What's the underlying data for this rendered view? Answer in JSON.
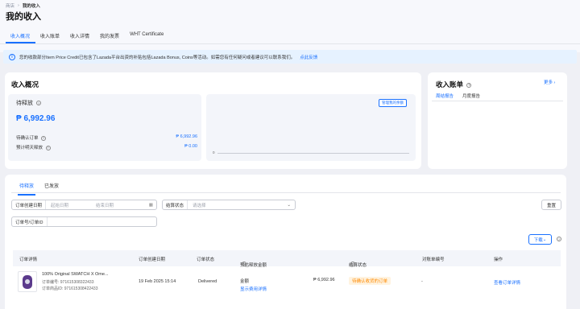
{
  "breadcrumb": {
    "home": "商店",
    "current": "我的收入"
  },
  "page_title": "我的收入",
  "tabs": [
    "收入概况",
    "收入账单",
    "收入详情",
    "我的发票",
    "WHT Certificate"
  ],
  "notice": {
    "text": "您的收款部分Item Price Credit已包含了Lazada平台出资的补贴包括Lazada Bonus, Coins等活动。如需您有任何疑问或者建议可以联系我们。",
    "link": "点此反馈"
  },
  "overview": {
    "title": "收入概况",
    "pending_label": "待释放",
    "pending_amount": "₱ 6,992.96",
    "to_confirm_label": "待确认订单",
    "to_confirm_value": "₱ 6,992.96",
    "expected_label": "预计明天释放",
    "expected_value": "₱ 0.00",
    "manage_button": "管理我的余额",
    "chart_zero": "0"
  },
  "statement": {
    "title": "收入账单",
    "more": "更多",
    "tabs": [
      "周结报告",
      "月度报告"
    ]
  },
  "details": {
    "subtabs": [
      "待释放",
      "已发放"
    ],
    "filters": {
      "created_date_label": "订单创建日期",
      "start_placeholder": "起始日期",
      "end_placeholder": "结束日期",
      "settle_status_label": "结算状态",
      "settle_status_placeholder": "请选择",
      "order_id_label": "订单号/订单ID"
    },
    "reset": "重置",
    "download": "下载",
    "columns": [
      "订单详情",
      "订单创建日期",
      "订单状态",
      "预估释放金额",
      "结算状态",
      "对账单编号",
      "操作"
    ],
    "row": {
      "product": "100% Original SWATCH X Ome...",
      "order_no": "订单编号: 971615308322433",
      "order_id": "订单商品ID: 971615308422433",
      "date": "19 Feb 2025 15:14",
      "status": "Delivered",
      "amount_label": "金额",
      "amount": "₱ 6,992.96",
      "fee_detail": "显示费用详情",
      "settle_status": "待确认收货的订单",
      "statement_no": "-",
      "action": "查看订单详情"
    }
  },
  "colors": {
    "accent": "#1a71ff",
    "warning_bg": "#fff3e0",
    "warning_text": "#ff8a00"
  }
}
